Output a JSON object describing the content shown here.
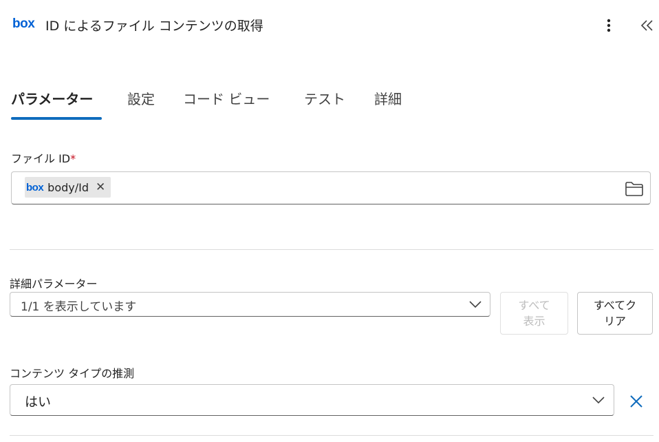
{
  "header": {
    "brand": "box",
    "title": "ID によるファイル コンテンツの取得"
  },
  "tabs": [
    {
      "label": "パラメーター",
      "active": true
    },
    {
      "label": "設定"
    },
    {
      "label": "コード ビュー"
    },
    {
      "label": "テスト"
    },
    {
      "label": "詳細"
    }
  ],
  "file_id": {
    "label": "ファイル ID",
    "required_mark": "*",
    "token": {
      "brand": "box",
      "text": "body/Id"
    }
  },
  "advanced": {
    "label": "詳細パラメーター",
    "select_value": "1/1 を表示しています",
    "show_all_line1": "すべて",
    "show_all_line2": "表示",
    "clear_all_line1": "すべてク",
    "clear_all_line2": "リア"
  },
  "content_type": {
    "label": "コンテンツ タイプの推測",
    "value": "はい"
  },
  "colors": {
    "accent": "#0f6cbd",
    "box_brand": "#0061d5",
    "required": "#c50f1f"
  },
  "icons": [
    "more-vertical-icon",
    "double-chevron-left-icon",
    "close-icon",
    "folder-icon",
    "chevron-down-icon"
  ]
}
